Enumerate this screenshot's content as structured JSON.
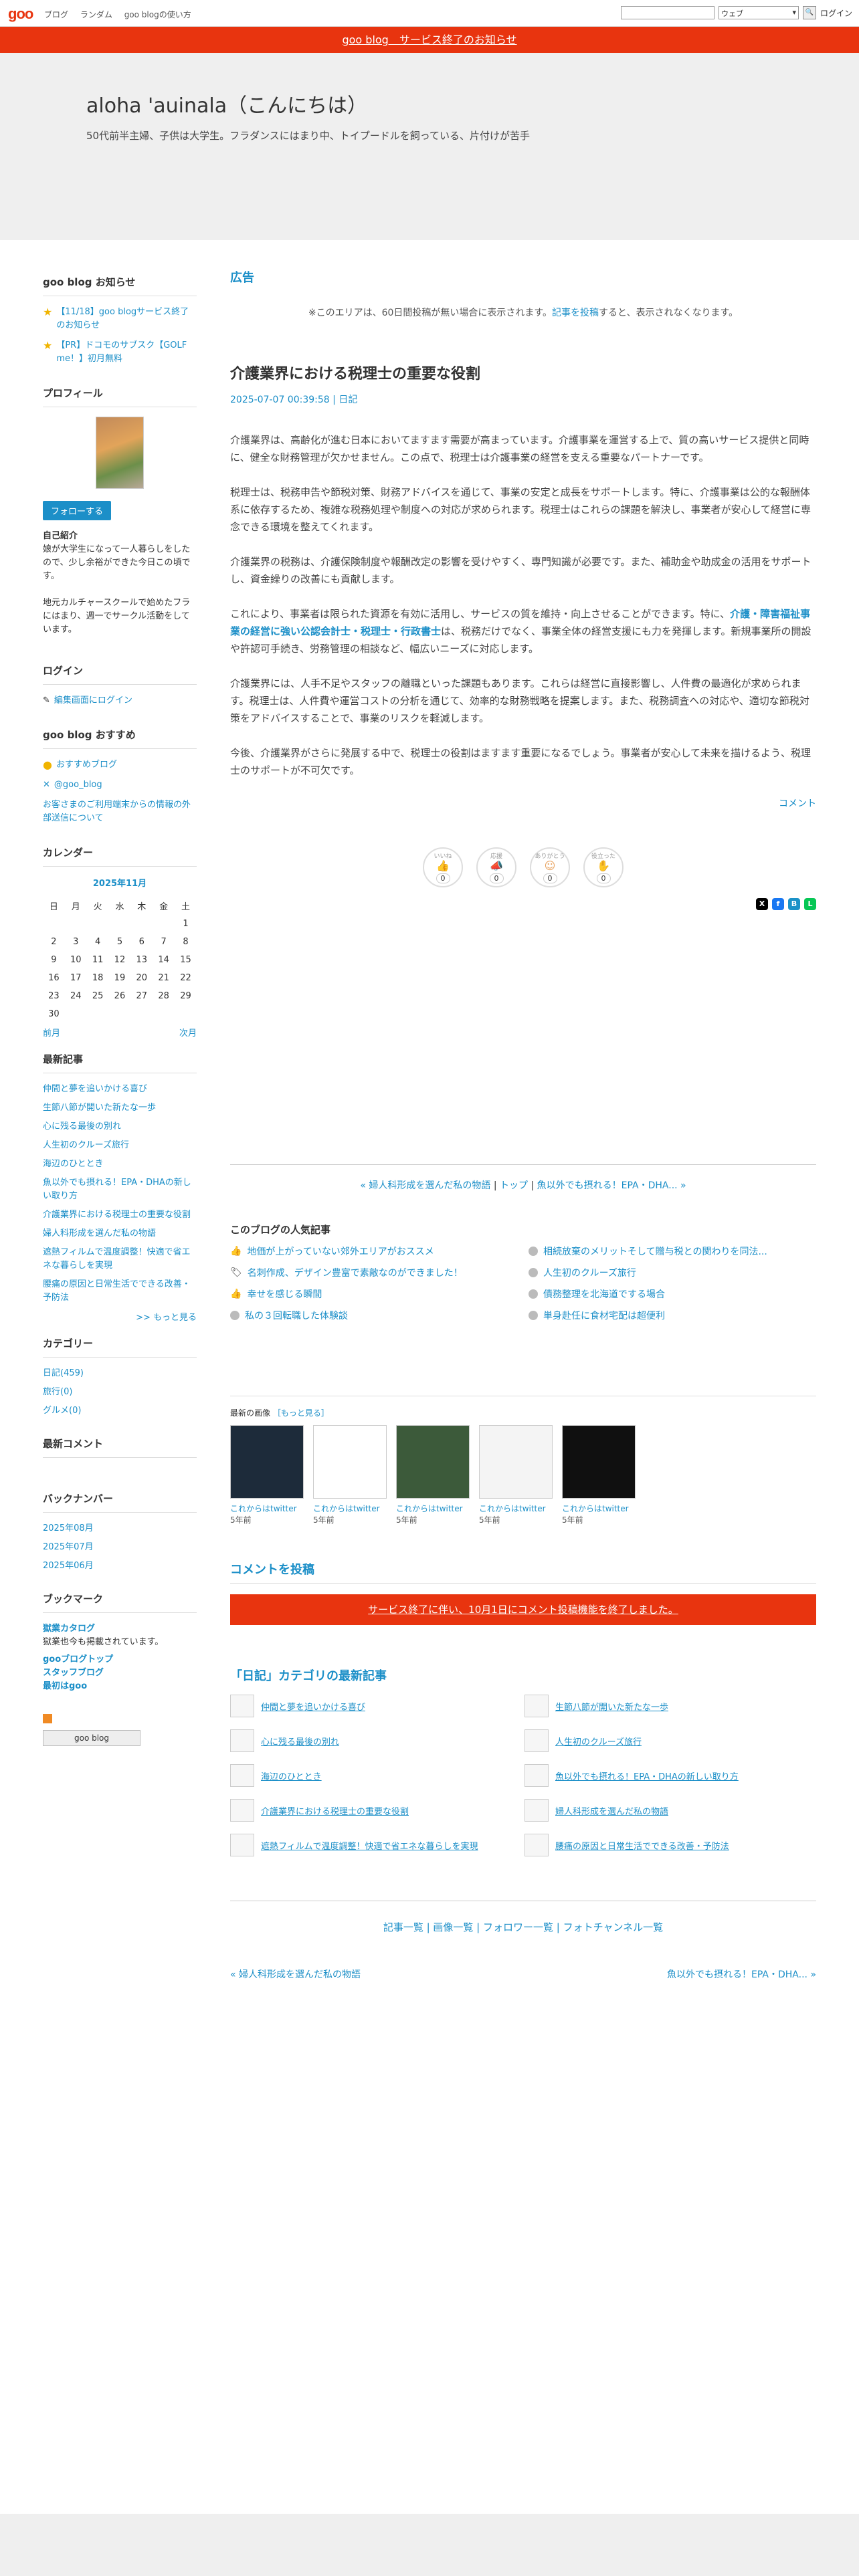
{
  "topbar": {
    "logo": "goo",
    "links": [
      "ブログ",
      "ランダム",
      "goo blogの使い方"
    ],
    "search_select": "ウェブ",
    "login": "ログイン"
  },
  "notice": "goo blog　サービス終了のお知らせ",
  "blog": {
    "title": "aloha 'auinala（こんにちは）",
    "subtitle": "50代前半主婦、子供は大学生。フラダンスにはまり中、トイプードルを飼っている、片付けが苦手"
  },
  "sidebar": {
    "news_title": "goo blog お知らせ",
    "news": [
      "【11/18】goo blogサービス終了のお知らせ",
      "【PR】ドコモのサブスク【GOLF me！】初月無料"
    ],
    "profile_title": "プロフィール",
    "follow": "フォローする",
    "intro_label": "自己紹介",
    "intro": "娘が大学生になって一人暮らしをしたので、少し余裕ができた今日この頃です。",
    "intro2": "地元カルチャースクールで始めたフラにはまり、週一でサークル活動をしています。",
    "login_title": "ログイン",
    "login_link": "編集画面にログイン",
    "recommend_title": "goo blog おすすめ",
    "recommend": [
      "おすすめブログ",
      "@goo_blog",
      "お客さまのご利用端末からの情報の外部送信について"
    ],
    "calendar_title": "カレンダー",
    "calendar": {
      "month": "2025年11月",
      "days": [
        "日",
        "月",
        "火",
        "水",
        "木",
        "金",
        "土"
      ],
      "weeks": [
        [
          "",
          "",
          "",
          "",
          "",
          "",
          "1"
        ],
        [
          "2",
          "3",
          "4",
          "5",
          "6",
          "7",
          "8"
        ],
        [
          "9",
          "10",
          "11",
          "12",
          "13",
          "14",
          "15"
        ],
        [
          "16",
          "17",
          "18",
          "19",
          "20",
          "21",
          "22"
        ],
        [
          "23",
          "24",
          "25",
          "26",
          "27",
          "28",
          "29"
        ],
        [
          "30",
          "",
          "",
          "",
          "",
          "",
          ""
        ]
      ],
      "prev": "前月",
      "next": "次月"
    },
    "recent_title": "最新記事",
    "recent": [
      "仲間と夢を追いかける喜び",
      "生節八節が開いた新たな一歩",
      "心に残る最後の別れ",
      "人生初のクルーズ旅行",
      "海辺のひととき",
      "魚以外でも摂れる！EPA・DHAの新しい取り方",
      "介護業界における税理士の重要な役割",
      "婦人科形成を選んだ私の物語",
      "遮熱フィルムで温度調整！快適で省エネな暮らしを実現",
      "腰痛の原因と日常生活でできる改善・予防法"
    ],
    "more": ">> もっと見る",
    "category_title": "カテゴリー",
    "categories": [
      "日記(459)",
      "旅行(0)",
      "グルメ(0)"
    ],
    "comments_title": "最新コメント",
    "backnumber_title": "バックナンバー",
    "backnumbers": [
      "2025年08月",
      "2025年07月",
      "2025年06月"
    ],
    "bookmark_title": "ブックマーク",
    "bookmarks": [
      {
        "name": "獄業カタログ",
        "desc": "獄業也今も掲載されています。"
      },
      {
        "name": "gooブログトップ",
        "desc": ""
      },
      {
        "name": "スタッフブログ",
        "desc": ""
      },
      {
        "name": "最初はgoo",
        "desc": ""
      }
    ],
    "badge": "goo blog"
  },
  "main": {
    "ad_title": "広告",
    "ad_note_pre": "※このエリアは、60日間投稿が無い場合に表示されます。",
    "ad_note_link": "記事を投稿",
    "ad_note_post": "すると、表示されなくなります。",
    "post": {
      "title": "介護業界における税理士の重要な役割",
      "date": "2025-07-07 00:39:58",
      "category": "日記",
      "p1": "介護業界は、高齢化が進む日本においてますます需要が高まっています。介護事業を運営する上で、質の高いサービス提供と同時に、健全な財務管理が欠かせません。この点で、税理士は介護事業の経営を支える重要なパートナーです。",
      "p2": "税理士は、税務申告や節税対策、財務アドバイスを通じて、事業の安定と成長をサポートします。特に、介護事業は公的な報酬体系に依存するため、複雑な税務処理や制度への対応が求められます。税理士はこれらの課題を解決し、事業者が安心して経営に専念できる環境を整えてくれます。",
      "p3": "介護業界の税務は、介護保険制度や報酬改定の影響を受けやすく、専門知識が必要です。また、補助金や助成金の活用をサポートし、資金繰りの改善にも貢献します。",
      "p4a": "これにより、事業者は限られた資源を有効に活用し、サービスの質を維持・向上させることができます。特に、",
      "p4link": "介護・障害福祉事業の経営に強い公認会計士・税理士・行政書士",
      "p4b": "は、税務だけでなく、事業全体の経営支援にも力を発揮します。新規事業所の開設や許認可手続き、労務管理の相談など、幅広いニーズに対応します。",
      "p5": "介護業界には、人手不足やスタッフの離職といった課題もあります。これらは経営に直接影響し、人件費の最適化が求められます。税理士は、人件費や運営コストの分析を通じて、効率的な財務戦略を提案します。また、税務調査への対応や、適切な節税対策をアドバイスすることで、事業のリスクを軽減します。",
      "p6": "今後、介護業界がさらに発展する中で、税理士の役割はますます重要になるでしょう。事業者が安心して未来を描けるよう、税理士のサポートが不可欠です。"
    },
    "comment_link": "コメント",
    "reactions": [
      {
        "label": "いいね",
        "count": "0"
      },
      {
        "label": "応援",
        "count": "0"
      },
      {
        "label": "ありがとう",
        "count": "0"
      },
      {
        "label": "役立った",
        "count": "0"
      }
    ],
    "postnav": {
      "prev": "« 婦人科形成を選んだ私の物語",
      "top": "トップ",
      "next": "魚以外でも摂れる！EPA・DHA... »"
    },
    "popular_title": "このブログの人気記事",
    "popular": [
      "地価が上がっていない郊外エリアがおススメ",
      "相続放棄のメリットそして贈与税との関わりを同法...",
      "名刺作成、デザイン豊富で素敵なのができました！",
      "人生初のクルーズ旅行",
      "幸せを感じる瞬間",
      "債務整理を北海道でする場合",
      "私の３回転職した体験談",
      "単身赴任に食材宅配は超便利"
    ],
    "images_title": "最新の画像",
    "images_more": "［もっと見る］",
    "images": [
      {
        "title": "これからはtwitter",
        "age": "5年前"
      },
      {
        "title": "これからはtwitter",
        "age": "5年前"
      },
      {
        "title": "これからはtwitter",
        "age": "5年前"
      },
      {
        "title": "これからはtwitter",
        "age": "5年前"
      },
      {
        "title": "これからはtwitter",
        "age": "5年前"
      }
    ],
    "comment_title": "コメントを投稿",
    "comment_closed": "サービス終了に伴い、10月1日にコメント投稿機能を終了しました。",
    "cat_title": "「日記」カテゴリの最新記事",
    "cat_posts": [
      "仲間と夢を追いかける喜び",
      "生節八節が開いた新たな一歩",
      "心に残る最後の別れ",
      "人生初のクルーズ旅行",
      "海辺のひととき",
      "魚以外でも摂れる！EPA・DHAの新しい取り方",
      "介護業界における税理士の重要な役割",
      "婦人科形成を選んだ私の物語",
      "遮熱フィルムで温度調整！快適で省エネな暮らしを実現",
      "腰痛の原因と日常生活でできる改善・予防法"
    ],
    "bottom_links": "記事一覧 | 画像一覧 | フォロワー一覧 | フォトチャンネル一覧",
    "bottom_prev": "« 婦人科形成を選んだ私の物語",
    "bottom_next": "魚以外でも摂れる！EPA・DHA... »"
  }
}
